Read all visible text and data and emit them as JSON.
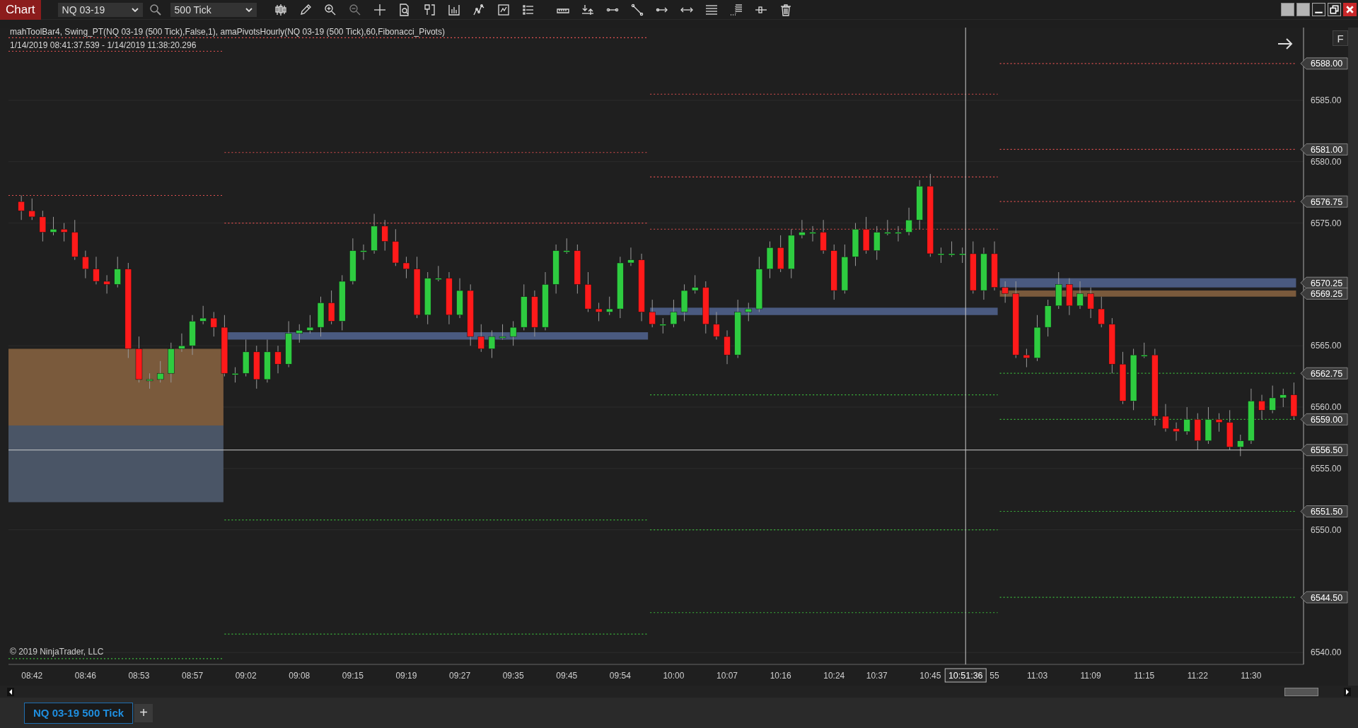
{
  "toolbar": {
    "title": "Chart",
    "instrument": "NQ 03-19",
    "interval": "500 Tick"
  },
  "legend": [
    "mahToolBar4, Swing_PT(NQ 03-19 (500 Tick),False,1), amaPivotsHourly(NQ 03-19 (500 Tick),60,Fibonacci_Pivots)",
    "1/14/2019 08:41:37.539 - 1/14/2019 11:38:20.296"
  ],
  "fit_button": "F",
  "copyright": "© 2019 NinjaTrader, LLC",
  "chart_data": {
    "type": "candlestick",
    "grid": true,
    "ylim": [
      6539.03,
      6590.93
    ],
    "yticks": [
      {
        "value": 6585,
        "label": "6585.00"
      },
      {
        "value": 6580,
        "label": "6580.00"
      },
      {
        "value": 6575,
        "label": "6575.00"
      },
      {
        "value": 6565,
        "label": "6565.00"
      },
      {
        "value": 6560,
        "label": "6560.00"
      },
      {
        "value": 6555,
        "label": "6555.00"
      },
      {
        "value": 6550,
        "label": "6550.00"
      },
      {
        "value": 6540,
        "label": "6540.00"
      }
    ],
    "categories": [
      null,
      "08:42",
      null,
      null,
      null,
      null,
      "08:46",
      null,
      null,
      null,
      null,
      "08:53",
      null,
      null,
      null,
      null,
      "08:57",
      null,
      null,
      null,
      null,
      "09:02",
      null,
      null,
      null,
      null,
      "09:08",
      null,
      null,
      null,
      null,
      "09:15",
      null,
      null,
      null,
      null,
      "09:19",
      null,
      null,
      null,
      null,
      "09:27",
      null,
      null,
      null,
      null,
      "09:35",
      null,
      null,
      null,
      null,
      "09:45",
      null,
      null,
      null,
      null,
      "09:54",
      null,
      null,
      null,
      null,
      "10:00",
      null,
      null,
      null,
      null,
      "10:07",
      null,
      null,
      null,
      null,
      "10:16",
      null,
      null,
      null,
      null,
      "10:24",
      null,
      null,
      null,
      "10:37",
      null,
      null,
      null,
      null,
      "10:45",
      null,
      null,
      null,
      null,
      null,
      "55",
      null,
      null,
      null,
      "11:03",
      null,
      null,
      null,
      null,
      "11:09",
      null,
      null,
      null,
      null,
      "11:15",
      null,
      null,
      null,
      null,
      "11:22",
      null,
      null,
      null,
      null,
      "11:30",
      null,
      null,
      null,
      null
    ],
    "ohlc": [
      [
        6576.75,
        6577.25,
        6575.25,
        6576.0
      ],
      [
        6576.0,
        6577.0,
        6575.25,
        6575.5
      ],
      [
        6575.5,
        6576.0,
        6573.5,
        6574.25
      ],
      [
        6574.25,
        6575.5,
        6574.0,
        6574.5
      ],
      [
        6574.5,
        6575.0,
        6573.5,
        6574.25
      ],
      [
        6574.25,
        6575.25,
        6572.0,
        6572.25
      ],
      [
        6572.25,
        6572.75,
        6570.5,
        6571.25
      ],
      [
        6571.25,
        6572.25,
        6570.0,
        6570.25
      ],
      [
        6570.25,
        6570.75,
        6569.25,
        6570.0
      ],
      [
        6570.0,
        6572.25,
        6569.75,
        6571.25
      ],
      [
        6571.25,
        6571.75,
        6564.0,
        6564.75
      ],
      [
        6564.75,
        6565.75,
        6562.0,
        6562.25
      ],
      [
        6562.25,
        6562.75,
        6561.5,
        6562.25
      ],
      [
        6562.25,
        6563.75,
        6562.0,
        6562.75
      ],
      [
        6562.75,
        6565.25,
        6562.0,
        6564.75
      ],
      [
        6564.75,
        6566.0,
        6564.5,
        6565.0
      ],
      [
        6565.0,
        6567.5,
        6564.25,
        6567.0
      ],
      [
        6567.0,
        6568.25,
        6566.75,
        6567.25
      ],
      [
        6567.25,
        6567.75,
        6565.75,
        6566.5
      ],
      [
        6566.5,
        6567.5,
        6562.5,
        6562.75
      ],
      [
        6562.75,
        6563.25,
        6562.0,
        6562.75
      ],
      [
        6562.75,
        6565.5,
        6562.5,
        6564.5
      ],
      [
        6564.5,
        6565.0,
        6561.5,
        6562.25
      ],
      [
        6562.25,
        6565.5,
        6562.0,
        6564.5
      ],
      [
        6564.5,
        6565.0,
        6562.75,
        6563.5
      ],
      [
        6563.5,
        6567.0,
        6563.25,
        6566.0
      ],
      [
        6566.0,
        6566.75,
        6565.25,
        6566.25
      ],
      [
        6566.25,
        6567.5,
        6566.0,
        6566.5
      ],
      [
        6566.5,
        6569.0,
        6565.75,
        6568.5
      ],
      [
        6568.5,
        6569.5,
        6566.75,
        6567.0
      ],
      [
        6567.0,
        6570.75,
        6566.25,
        6570.25
      ],
      [
        6570.25,
        6573.75,
        6570.0,
        6572.75
      ],
      [
        6572.75,
        6573.25,
        6572.0,
        6572.75
      ],
      [
        6572.75,
        6575.75,
        6572.5,
        6574.75
      ],
      [
        6574.75,
        6575.25,
        6572.75,
        6573.5
      ],
      [
        6573.5,
        6574.5,
        6571.5,
        6571.75
      ],
      [
        6571.75,
        6572.25,
        6570.5,
        6571.25
      ],
      [
        6571.25,
        6572.25,
        6567.25,
        6567.5
      ],
      [
        6567.5,
        6571.0,
        6566.75,
        6570.5
      ],
      [
        6570.5,
        6571.5,
        6570.25,
        6570.5
      ],
      [
        6570.5,
        6571.0,
        6566.75,
        6567.5
      ],
      [
        6567.5,
        6570.5,
        6567.25,
        6569.5
      ],
      [
        6569.5,
        6570.0,
        6565.0,
        6565.75
      ],
      [
        6565.75,
        6566.75,
        6564.5,
        6564.75
      ],
      [
        6564.75,
        6566.25,
        6564.0,
        6565.75
      ],
      [
        6565.75,
        6566.75,
        6565.5,
        6565.75
      ],
      [
        6565.75,
        6567.0,
        6565.0,
        6566.5
      ],
      [
        6566.5,
        6570.0,
        6566.25,
        6569.0
      ],
      [
        6569.0,
        6569.5,
        6565.75,
        6566.5
      ],
      [
        6566.5,
        6571.0,
        6566.25,
        6570.0
      ],
      [
        6570.0,
        6573.25,
        6569.25,
        6572.75
      ],
      [
        6572.75,
        6573.75,
        6572.5,
        6572.75
      ],
      [
        6572.75,
        6573.25,
        6569.25,
        6570.0
      ],
      [
        6570.0,
        6571.0,
        6567.75,
        6568.0
      ],
      [
        6568.0,
        6568.5,
        6567.0,
        6567.75
      ],
      [
        6567.75,
        6569.0,
        6567.5,
        6568.0
      ],
      [
        6568.0,
        6572.25,
        6567.25,
        6571.75
      ],
      [
        6571.75,
        6573.0,
        6571.5,
        6572.0
      ],
      [
        6572.0,
        6572.5,
        6567.0,
        6567.75
      ],
      [
        6567.75,
        6568.75,
        6566.5,
        6566.75
      ],
      [
        6566.75,
        6567.25,
        6566.0,
        6566.75
      ],
      [
        6566.75,
        6568.75,
        6566.5,
        6567.75
      ],
      [
        6567.75,
        6570.0,
        6567.0,
        6569.5
      ],
      [
        6569.5,
        6570.75,
        6569.25,
        6569.75
      ],
      [
        6569.75,
        6570.25,
        6566.0,
        6566.75
      ],
      [
        6566.75,
        6567.75,
        6565.5,
        6565.75
      ],
      [
        6565.75,
        6566.25,
        6563.5,
        6564.25
      ],
      [
        6564.25,
        6568.75,
        6564.0,
        6567.75
      ],
      [
        6567.75,
        6568.5,
        6567.0,
        6568.0
      ],
      [
        6568.0,
        6572.25,
        6567.75,
        6571.25
      ],
      [
        6571.25,
        6573.5,
        6570.5,
        6573.0
      ],
      [
        6573.0,
        6574.0,
        6571.0,
        6571.25
      ],
      [
        6571.25,
        6574.5,
        6570.5,
        6574.0
      ],
      [
        6574.0,
        6575.25,
        6573.75,
        6574.25
      ],
      [
        6574.25,
        6574.75,
        6573.5,
        6574.25
      ],
      [
        6574.25,
        6575.25,
        6572.5,
        6572.75
      ],
      [
        6572.75,
        6573.25,
        6568.75,
        6569.5
      ],
      [
        6569.5,
        6573.25,
        6569.25,
        6572.25
      ],
      [
        6572.25,
        6575.0,
        6571.5,
        6574.5
      ],
      [
        6574.5,
        6575.5,
        6572.5,
        6572.75
      ],
      [
        6572.75,
        6574.75,
        6572.0,
        6574.25
      ],
      [
        6574.25,
        6575.25,
        6574.0,
        6574.25
      ],
      [
        6574.25,
        6574.75,
        6573.5,
        6574.25
      ],
      [
        6574.25,
        6576.25,
        6574.0,
        6575.25
      ],
      [
        6575.25,
        6578.5,
        6574.5,
        6578.0
      ],
      [
        6578.0,
        6579.0,
        6572.25,
        6572.5
      ],
      [
        6572.5,
        6573.0,
        6571.75,
        6572.5
      ],
      [
        6572.5,
        6573.5,
        6572.25,
        6572.5
      ],
      [
        6572.5,
        6573.0,
        6571.75,
        6572.5
      ],
      [
        6572.5,
        6573.5,
        6569.25,
        6569.5
      ],
      [
        6569.5,
        6573.0,
        6568.75,
        6572.5
      ],
      [
        6572.5,
        6573.5,
        6569.5,
        6569.75
      ],
      [
        6569.75,
        6570.25,
        6568.5,
        6569.25
      ],
      [
        6569.25,
        6570.25,
        6564.0,
        6564.25
      ],
      [
        6564.25,
        6564.75,
        6563.25,
        6564.0
      ],
      [
        6564.0,
        6567.5,
        6563.75,
        6566.5
      ],
      [
        6566.5,
        6568.75,
        6565.75,
        6568.25
      ],
      [
        6568.25,
        6571.0,
        6568.0,
        6570.0
      ],
      [
        6570.0,
        6570.5,
        6567.5,
        6568.25
      ],
      [
        6568.25,
        6570.25,
        6568.0,
        6569.25
      ],
      [
        6569.25,
        6569.75,
        6567.25,
        6568.0
      ],
      [
        6568.0,
        6569.0,
        6566.5,
        6566.75
      ],
      [
        6566.75,
        6567.25,
        6562.75,
        6563.5
      ],
      [
        6563.5,
        6564.5,
        6560.25,
        6560.5
      ],
      [
        6560.5,
        6564.75,
        6559.75,
        6564.25
      ],
      [
        6564.25,
        6565.25,
        6564.0,
        6564.25
      ],
      [
        6564.25,
        6564.75,
        6558.5,
        6559.25
      ],
      [
        6559.25,
        6560.25,
        6558.0,
        6558.25
      ],
      [
        6558.25,
        6558.75,
        6557.25,
        6558.0
      ],
      [
        6558.0,
        6560.0,
        6557.75,
        6559.0
      ],
      [
        6559.0,
        6559.5,
        6556.5,
        6557.25
      ],
      [
        6557.25,
        6560.0,
        6557.0,
        6559.0
      ],
      [
        6559.0,
        6559.5,
        6558.0,
        6558.75
      ],
      [
        6558.75,
        6559.75,
        6556.5,
        6556.75
      ],
      [
        6556.75,
        6557.75,
        6556.0,
        6557.25
      ],
      [
        6557.25,
        6561.5,
        6557.0,
        6560.5
      ],
      [
        6560.5,
        6561.0,
        6559.0,
        6559.75
      ],
      [
        6559.75,
        6561.75,
        6559.5,
        6560.75
      ],
      [
        6560.75,
        6561.5,
        6560.0,
        6561.0
      ],
      [
        6561.0,
        6562.0,
        6559.0,
        6559.25
      ]
    ],
    "bands": [
      {
        "axis": "y",
        "from": 6558.5,
        "to": 6564.75,
        "color": "#7a5a3c"
      },
      {
        "axis": "y",
        "from": 6552.25,
        "to": 6558.5,
        "color": "#4a5566"
      },
      {
        "axis": "y",
        "from": 6565.5,
        "to": 6566.1,
        "color": "#4a5a80"
      },
      {
        "axis": "y",
        "from": 6567.5,
        "to": 6568.1,
        "color": "#4a5a80"
      },
      {
        "axis": "y",
        "from": 6569.75,
        "to": 6570.5,
        "color": "#4a5a80",
        "label": "6570.25"
      },
      {
        "axis": "y",
        "from": 6569.0,
        "to": 6569.5,
        "color": "#7a5a3c",
        "label": "6569.25"
      }
    ],
    "ref_lines": [
      {
        "axis": "y",
        "value": 6590.1,
        "color": "#e05050"
      },
      {
        "axis": "y",
        "value": 6589.0,
        "color": "#e05050"
      },
      {
        "axis": "y",
        "value": 6577.25,
        "color": "#e05050"
      },
      {
        "axis": "y",
        "value": 6539.5,
        "color": "#3cba3c"
      },
      {
        "axis": "y",
        "value": 6580.75,
        "color": "#e05050"
      },
      {
        "axis": "y",
        "value": 6575.0,
        "color": "#e05050"
      },
      {
        "axis": "y",
        "value": 6550.8,
        "color": "#3cba3c"
      },
      {
        "axis": "y",
        "value": 6541.5,
        "color": "#3cba3c"
      },
      {
        "axis": "y",
        "value": 6585.5,
        "color": "#e05050"
      },
      {
        "axis": "y",
        "value": 6578.75,
        "color": "#e05050"
      },
      {
        "axis": "y",
        "value": 6574.5,
        "color": "#e05050"
      },
      {
        "axis": "y",
        "value": 6561.0,
        "color": "#3cba3c"
      },
      {
        "axis": "y",
        "value": 6550.0,
        "color": "#3cba3c"
      },
      {
        "axis": "y",
        "value": 6543.25,
        "color": "#3cba3c"
      },
      {
        "axis": "y",
        "value": 6588.0,
        "color": "#e05050",
        "label": "6588.00"
      },
      {
        "axis": "y",
        "value": 6581.0,
        "color": "#e05050",
        "label": "6581.00"
      },
      {
        "axis": "y",
        "value": 6576.75,
        "color": "#e05050",
        "label": "6576.75"
      },
      {
        "axis": "y",
        "value": 6562.75,
        "color": "#3cba3c",
        "label": "6562.75"
      },
      {
        "axis": "y",
        "value": 6559.0,
        "color": "#3cba3c",
        "label": "6559.00"
      },
      {
        "axis": "y",
        "value": 6556.5,
        "color": "#cccccc",
        "label": "6556.50"
      },
      {
        "axis": "y",
        "value": 6551.5,
        "color": "#3cba3c",
        "label": "6551.50"
      },
      {
        "axis": "y",
        "value": 6544.5,
        "color": "#3cba3c",
        "label": "6544.50"
      }
    ]
  },
  "crosshair": {
    "time_label": "10:51:36"
  },
  "tabs": [
    {
      "label": "NQ 03-19 500 Tick",
      "selected": true
    }
  ],
  "add_tab": "+"
}
